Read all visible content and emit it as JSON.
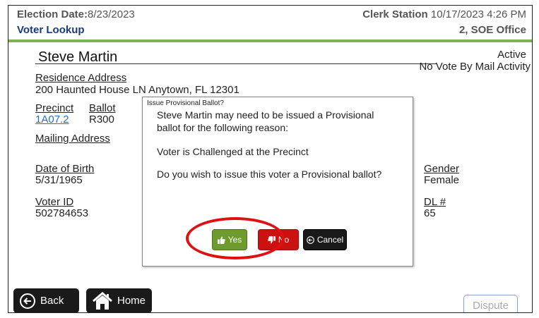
{
  "header": {
    "election_date_label": "Election Date:",
    "election_date_value": "8/23/2023",
    "screen_title": "Voter Lookup",
    "station_label": "Clerk Station",
    "station_datetime": "10/17/2023 4:26 PM",
    "office": "2, SOE Office"
  },
  "voter": {
    "name": "Steve Martin",
    "status": "Active",
    "vbm_status": "No Vote By Mail Activity",
    "residence_label": "Residence Address",
    "residence_value": "200 Haunted House LN Anytown, FL 12301",
    "precinct_label": "Precinct",
    "precinct_value": "1A07.2",
    "ballot_label": "Ballot",
    "ballot_value": "R300",
    "mailing_label": "Mailing Address",
    "dob_label": "Date of Birth",
    "dob_value": "5/31/1965",
    "gender_label": "Gender",
    "gender_value": "Female",
    "voter_id_label": "Voter ID",
    "voter_id_value": "502784653",
    "dl_label": "DL #",
    "dl_value": "65"
  },
  "dialog": {
    "title": "Issue Provisional Ballot?",
    "line1": "Steve Martin may need to be issued a Provisional",
    "line2": "ballot for the following reason:",
    "reason": "Voter is Challenged at the Precinct",
    "question": "Do you wish to issue this voter a Provisional ballot?",
    "yes_label": "Yes",
    "no_label": "No",
    "cancel_label": "Cancel"
  },
  "footer": {
    "back_label": "Back",
    "home_label": "Home",
    "dispute_label": "Dispute"
  },
  "icons": {
    "yes": "thumbs-up-icon",
    "no": "thumbs-down-icon",
    "cancel": "circle-back-arrow-icon",
    "back": "circle-back-arrow-icon",
    "home": "home-icon"
  },
  "colors": {
    "header_rule": "#7cb24f",
    "screen_title": "#1a3b7a",
    "link": "#2a6fb8",
    "yes": "#6f9a2e",
    "no": "#cc1111",
    "cancel": "#1a1a1a",
    "highlight_ring": "#dd1111"
  }
}
